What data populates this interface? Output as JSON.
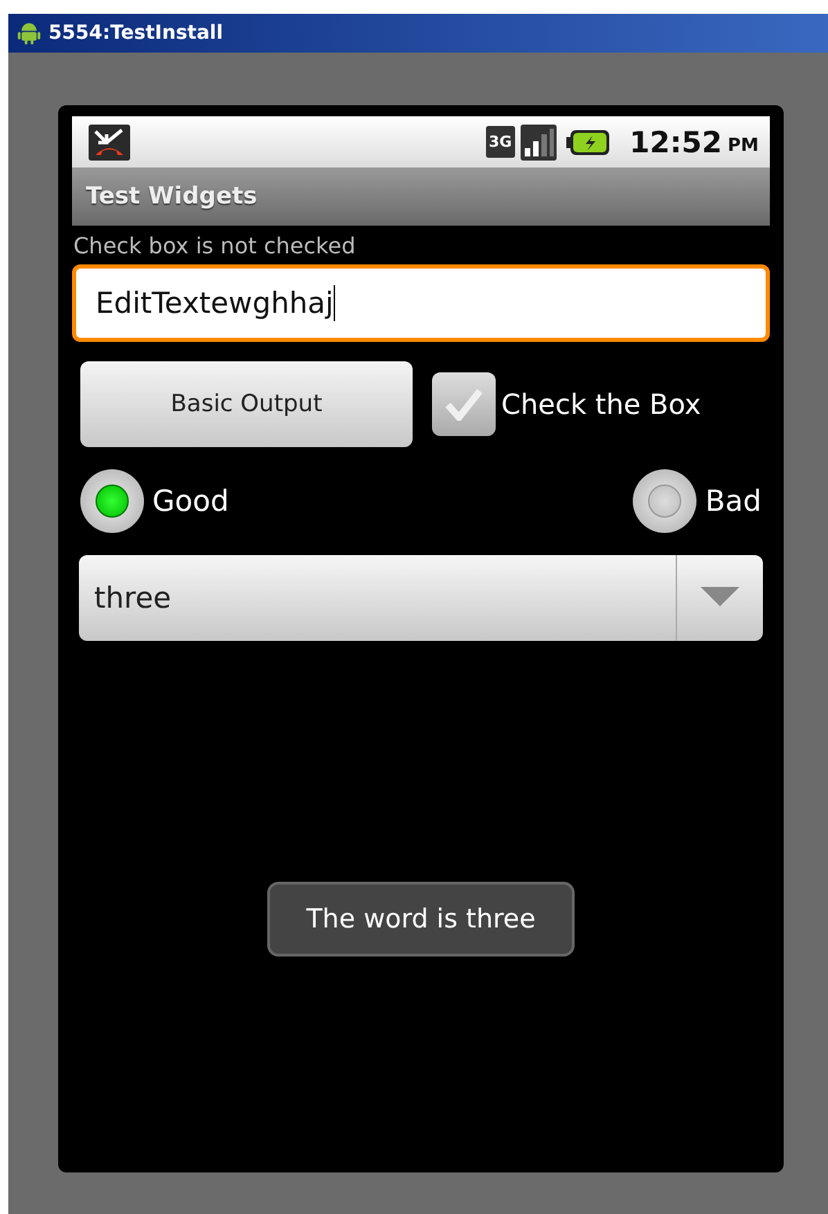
{
  "window": {
    "title": "5554:TestInstall"
  },
  "status_bar": {
    "network": "3G",
    "time": "12:52",
    "ampm": "PM"
  },
  "app_title": "Test Widgets",
  "status_text": "Check box is not checked",
  "edit_text": {
    "value": "EditTextewghhaj",
    "focused": true
  },
  "button": "Basic Output",
  "checkbox": {
    "label": "Check the Box",
    "checked": false
  },
  "radios": [
    {
      "label": "Good",
      "selected": true
    },
    {
      "label": "Bad",
      "selected": false
    }
  ],
  "spinner": {
    "value": "three"
  },
  "toast": "The word is three"
}
